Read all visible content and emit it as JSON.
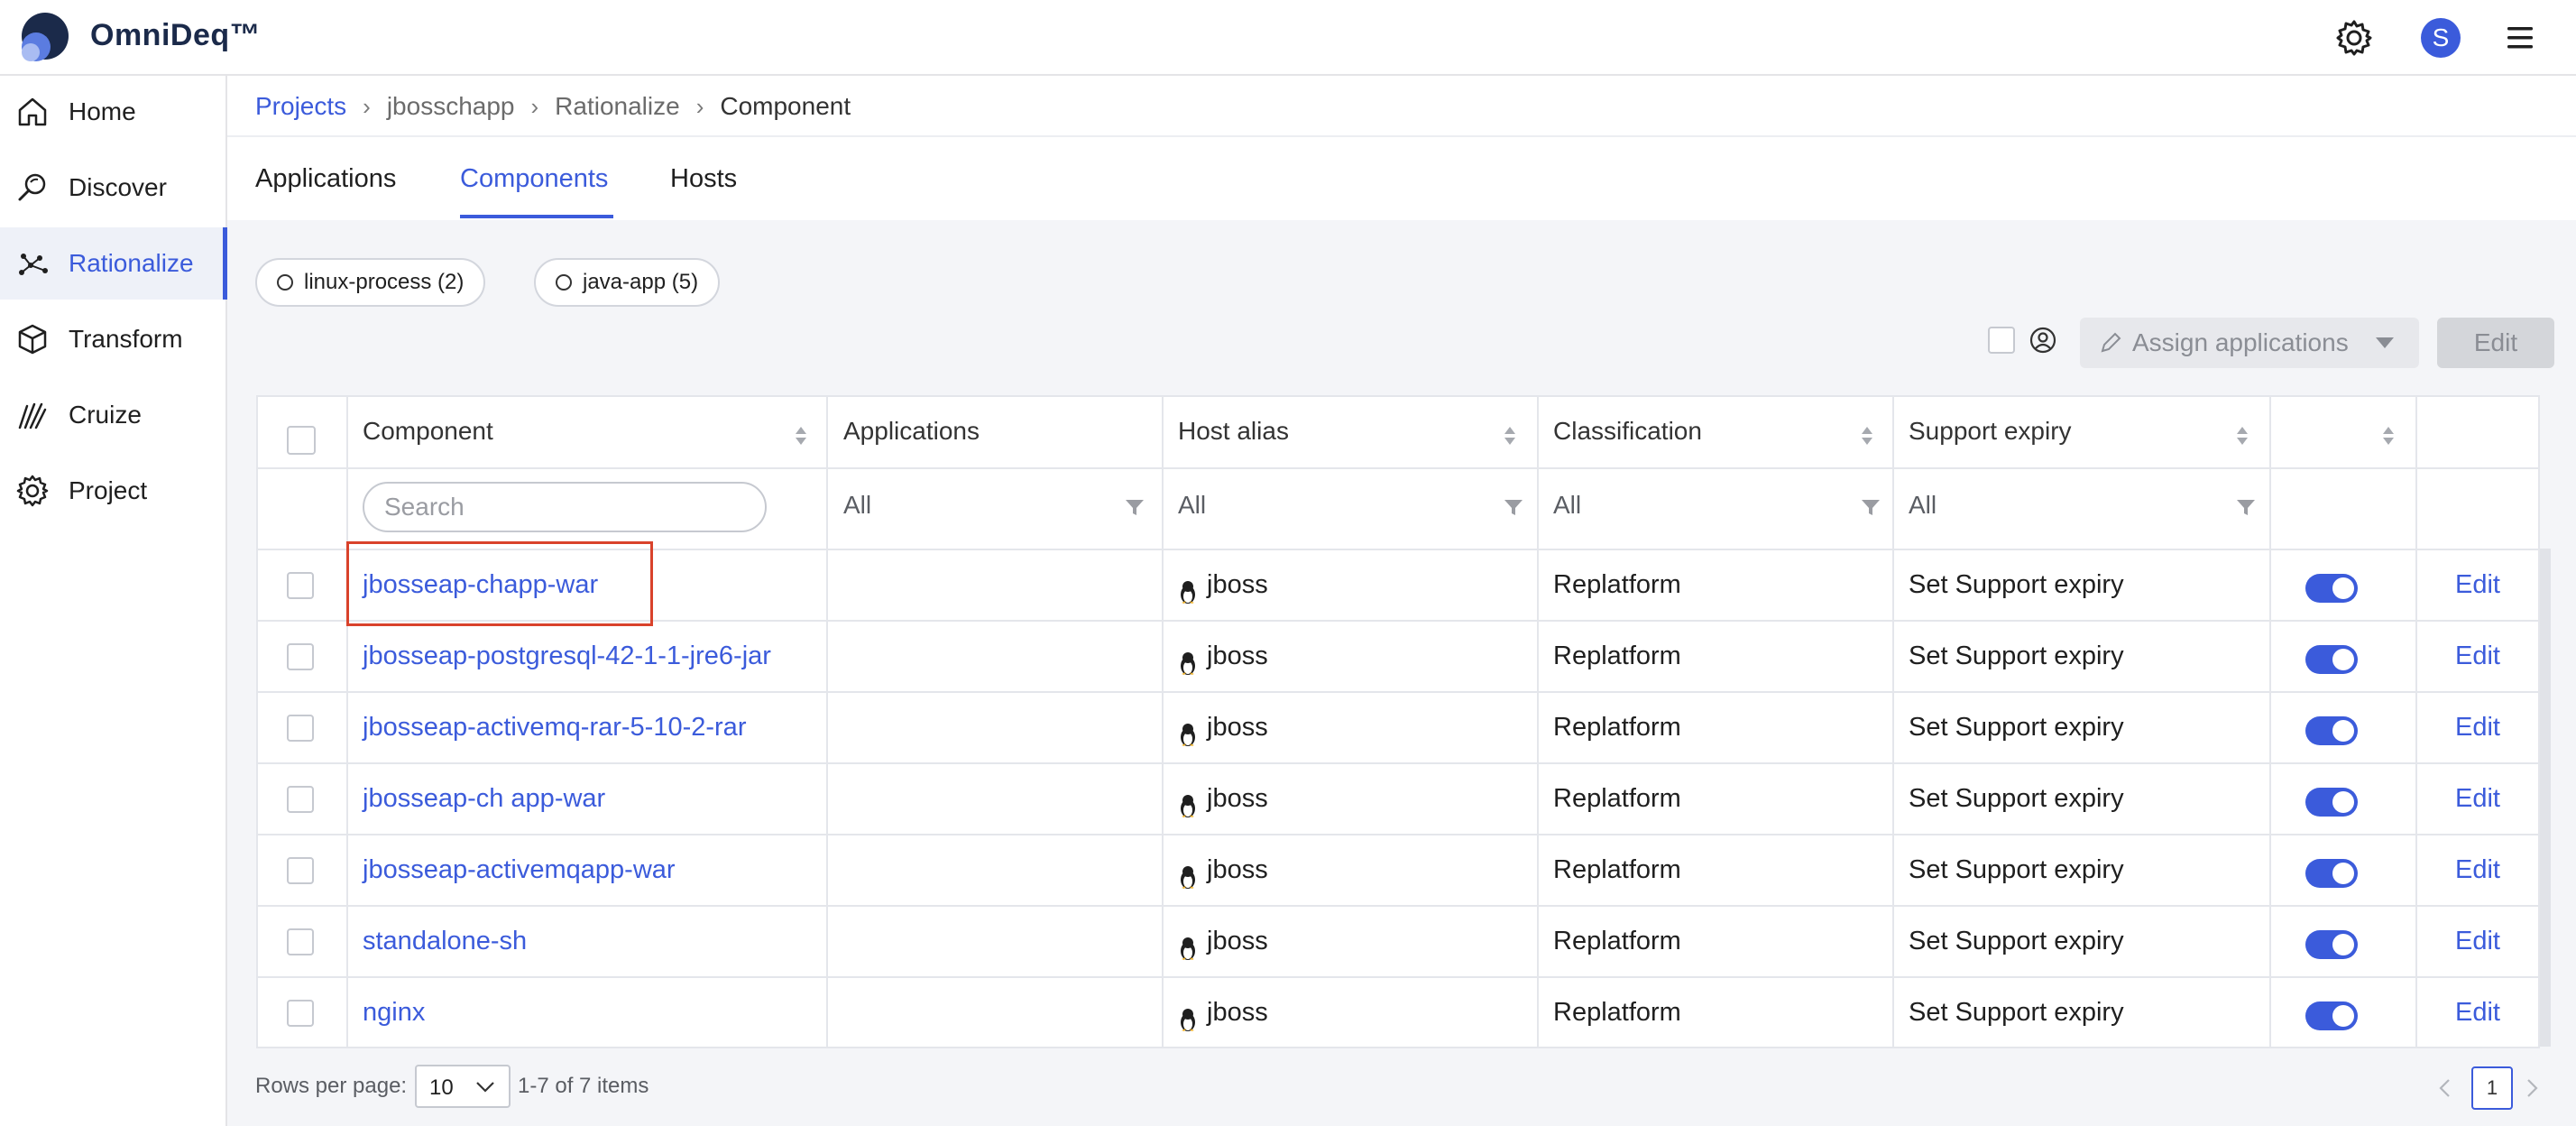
{
  "app": {
    "name": "OmniDeq™",
    "user_initial": "S"
  },
  "header": {
    "icons": [
      "gear-icon",
      "menu-icon"
    ]
  },
  "sidebar": {
    "items": [
      {
        "label": "Home",
        "icon": "home-icon"
      },
      {
        "label": "Discover",
        "icon": "discover-icon"
      },
      {
        "label": "Rationalize",
        "icon": "rationalize-icon",
        "active": true
      },
      {
        "label": "Transform",
        "icon": "cube-icon"
      },
      {
        "label": "Cruize",
        "icon": "cruize-icon"
      },
      {
        "label": "Project",
        "icon": "gear-icon"
      }
    ]
  },
  "breadcrumb": [
    "Projects",
    "jbosschapp",
    "Rationalize",
    "Component"
  ],
  "tabs": {
    "applications": "Applications",
    "components": "Components",
    "hosts": "Hosts"
  },
  "filters": {
    "chips": [
      "linux-process (2)",
      "java-app (5)"
    ]
  },
  "toolbar": {
    "assign_label": "Assign applications",
    "edit_label": "Edit"
  },
  "table": {
    "columns": [
      "Component",
      "Applications",
      "Host alias",
      "Classification",
      "Support expiry"
    ],
    "search_placeholder": "Search",
    "filter_all": "All",
    "rows": [
      {
        "component": "jbosseap-chapp-war",
        "host": "jboss",
        "classification": "Replatform",
        "support": "Set Support expiry",
        "enabled": true,
        "action": "Edit"
      },
      {
        "component": "jbosseap-postgresql-42-1-1-jre6-jar",
        "host": "jboss",
        "classification": "Replatform",
        "support": "Set Support expiry",
        "enabled": true,
        "action": "Edit"
      },
      {
        "component": "jbosseap-activemq-rar-5-10-2-rar",
        "host": "jboss",
        "classification": "Replatform",
        "support": "Set Support expiry",
        "enabled": true,
        "action": "Edit"
      },
      {
        "component": "jbosseap-ch app-war",
        "host": "jboss",
        "classification": "Replatform",
        "support": "Set Support expiry",
        "enabled": true,
        "action": "Edit"
      },
      {
        "component": "jbosseap-activemqapp-war",
        "host": "jboss",
        "classification": "Replatform",
        "support": "Set Support expiry",
        "enabled": true,
        "action": "Edit"
      },
      {
        "component": "standalone-sh",
        "host": "jboss",
        "classification": "Replatform",
        "support": "Set Support expiry",
        "enabled": true,
        "action": "Edit"
      },
      {
        "component": "nginx",
        "host": "jboss",
        "classification": "Replatform",
        "support": "Set Support expiry",
        "enabled": true,
        "action": "Edit"
      }
    ]
  },
  "footer": {
    "rows_per_page_label": "Rows per page:",
    "rows_per_page": "10",
    "items_text": "1-7 of 7 items",
    "page": "1"
  },
  "colors": {
    "accent": "#3b5bdb",
    "highlight": "#d9422b"
  }
}
